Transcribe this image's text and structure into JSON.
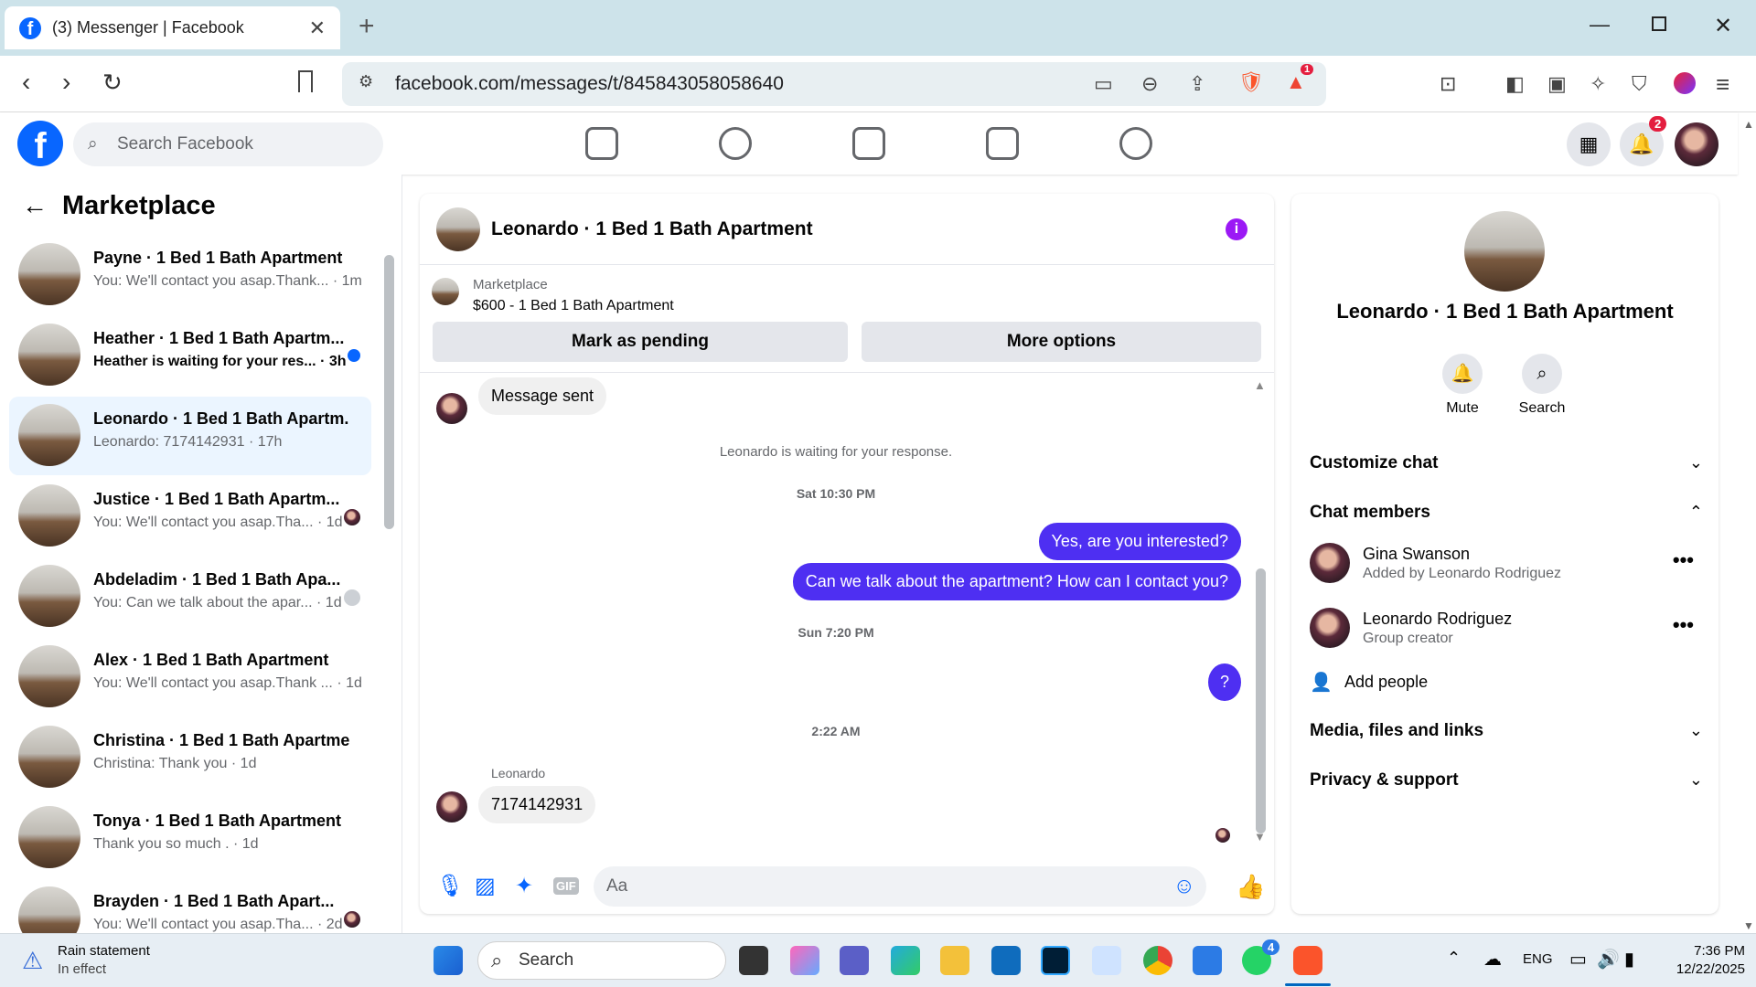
{
  "browser": {
    "tab_title": "(3) Messenger | Facebook",
    "tab_close": "✕",
    "new_tab": "+",
    "url": "facebook.com/messages/t/845843058058640",
    "brave_badge": "1"
  },
  "fb": {
    "search_placeholder": "Search Facebook",
    "notifications_count": "2"
  },
  "sidebar": {
    "title": "Marketplace",
    "conversations": [
      {
        "name": "Payne · 1 Bed 1 Bath Apartment",
        "preview": "You: We'll contact you asap.Thank... · 1m",
        "unread": false
      },
      {
        "name": "Heather · 1 Bed 1 Bath Apartm...",
        "preview": "Heather is waiting for your res... · 3h",
        "unread": true
      },
      {
        "name": "Leonardo · 1 Bed 1 Bath Apartm...",
        "preview": "Leonardo: 7174142931 · 17h",
        "unread": false
      },
      {
        "name": "Justice · 1 Bed 1 Bath Apartm...",
        "preview": "You: We'll contact you asap.Tha... · 1d",
        "unread": false
      },
      {
        "name": "Abdeladim · 1 Bed 1 Bath Apa...",
        "preview": "You: Can we talk about the apar... · 1d",
        "unread": false
      },
      {
        "name": "Alex · 1 Bed 1 Bath Apartment",
        "preview": "You: We'll contact you asap.Thank ... · 1d",
        "unread": false
      },
      {
        "name": "Christina · 1 Bed 1 Bath Apartme...",
        "preview": "Christina: Thank you · 1d",
        "unread": false
      },
      {
        "name": "Tonya · 1 Bed 1 Bath Apartment",
        "preview": "Thank you so much . · 1d",
        "unread": false
      },
      {
        "name": "Brayden · 1 Bed 1 Bath Apart...",
        "preview": "You: We'll contact you asap.Tha... · 2d",
        "unread": false
      }
    ]
  },
  "chat": {
    "title": "Leonardo · 1 Bed 1 Bath Apartment",
    "listing_source": "Marketplace",
    "listing_title": "$600 - 1 Bed 1 Bath Apartment",
    "mark_pending": "Mark as pending",
    "more_options": "More options",
    "messages": {
      "m1": "Message sent",
      "waiting": "Leonardo is waiting for your response.",
      "ts1": "Sat 10:30 PM",
      "m2": "Yes, are you interested?",
      "m3": "Can we talk about the apartment? How can I contact you?",
      "ts2": "Sun 7:20 PM",
      "m4": "?",
      "ts3": "2:22 AM",
      "sender": "Leonardo",
      "m5": "7174142931"
    },
    "composer_placeholder": "Aa",
    "gif_label": "GIF"
  },
  "details": {
    "name": "Leonardo · 1 Bed 1 Bath Apartment",
    "mute": "Mute",
    "search": "Search",
    "customize": "Customize chat",
    "members_title": "Chat members",
    "members": [
      {
        "name": "Gina Swanson",
        "sub": "Added by Leonardo Rodriguez"
      },
      {
        "name": "Leonardo Rodriguez",
        "sub": "Group creator"
      }
    ],
    "add_people": "Add people",
    "media": "Media, files and links",
    "privacy": "Privacy & support"
  },
  "taskbar": {
    "weather_title": "Rain statement",
    "weather_sub": "In effect",
    "search": "Search",
    "lang": "ENG",
    "time": "7:36 PM",
    "date": "12/22/2025",
    "whatsapp_badge": "4"
  },
  "colors": {
    "accent": "#0866ff",
    "bubble_out": "#4e2ff2",
    "info": "#9b19f5"
  }
}
